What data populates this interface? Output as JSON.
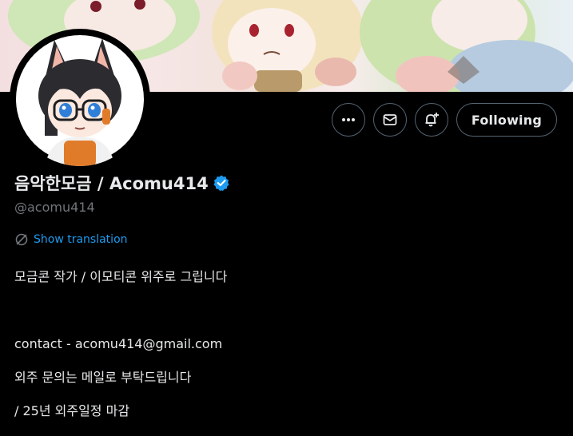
{
  "profile": {
    "display_name": "음악한모금 / Acomu414",
    "handle": "@acomu414",
    "verified": true,
    "show_translation_label": "Show translation",
    "bio_lines": [
      "모금콘 작가 / 이모티콘 위주로 그립니다",
      "",
      "contact - acomu414@gmail.com",
      "외주 문의는 메일로 부탁드립니다",
      "/ 25년 외주일정 마감"
    ]
  },
  "actions": {
    "more_icon": "more-horizontal-icon",
    "message_icon": "envelope-icon",
    "notify_icon": "bell-plus-icon",
    "follow_label": "Following"
  },
  "colors": {
    "background": "#000000",
    "text_primary": "#e7e9ea",
    "text_secondary": "#71767b",
    "accent": "#1d9bf0",
    "button_border": "#536471"
  }
}
